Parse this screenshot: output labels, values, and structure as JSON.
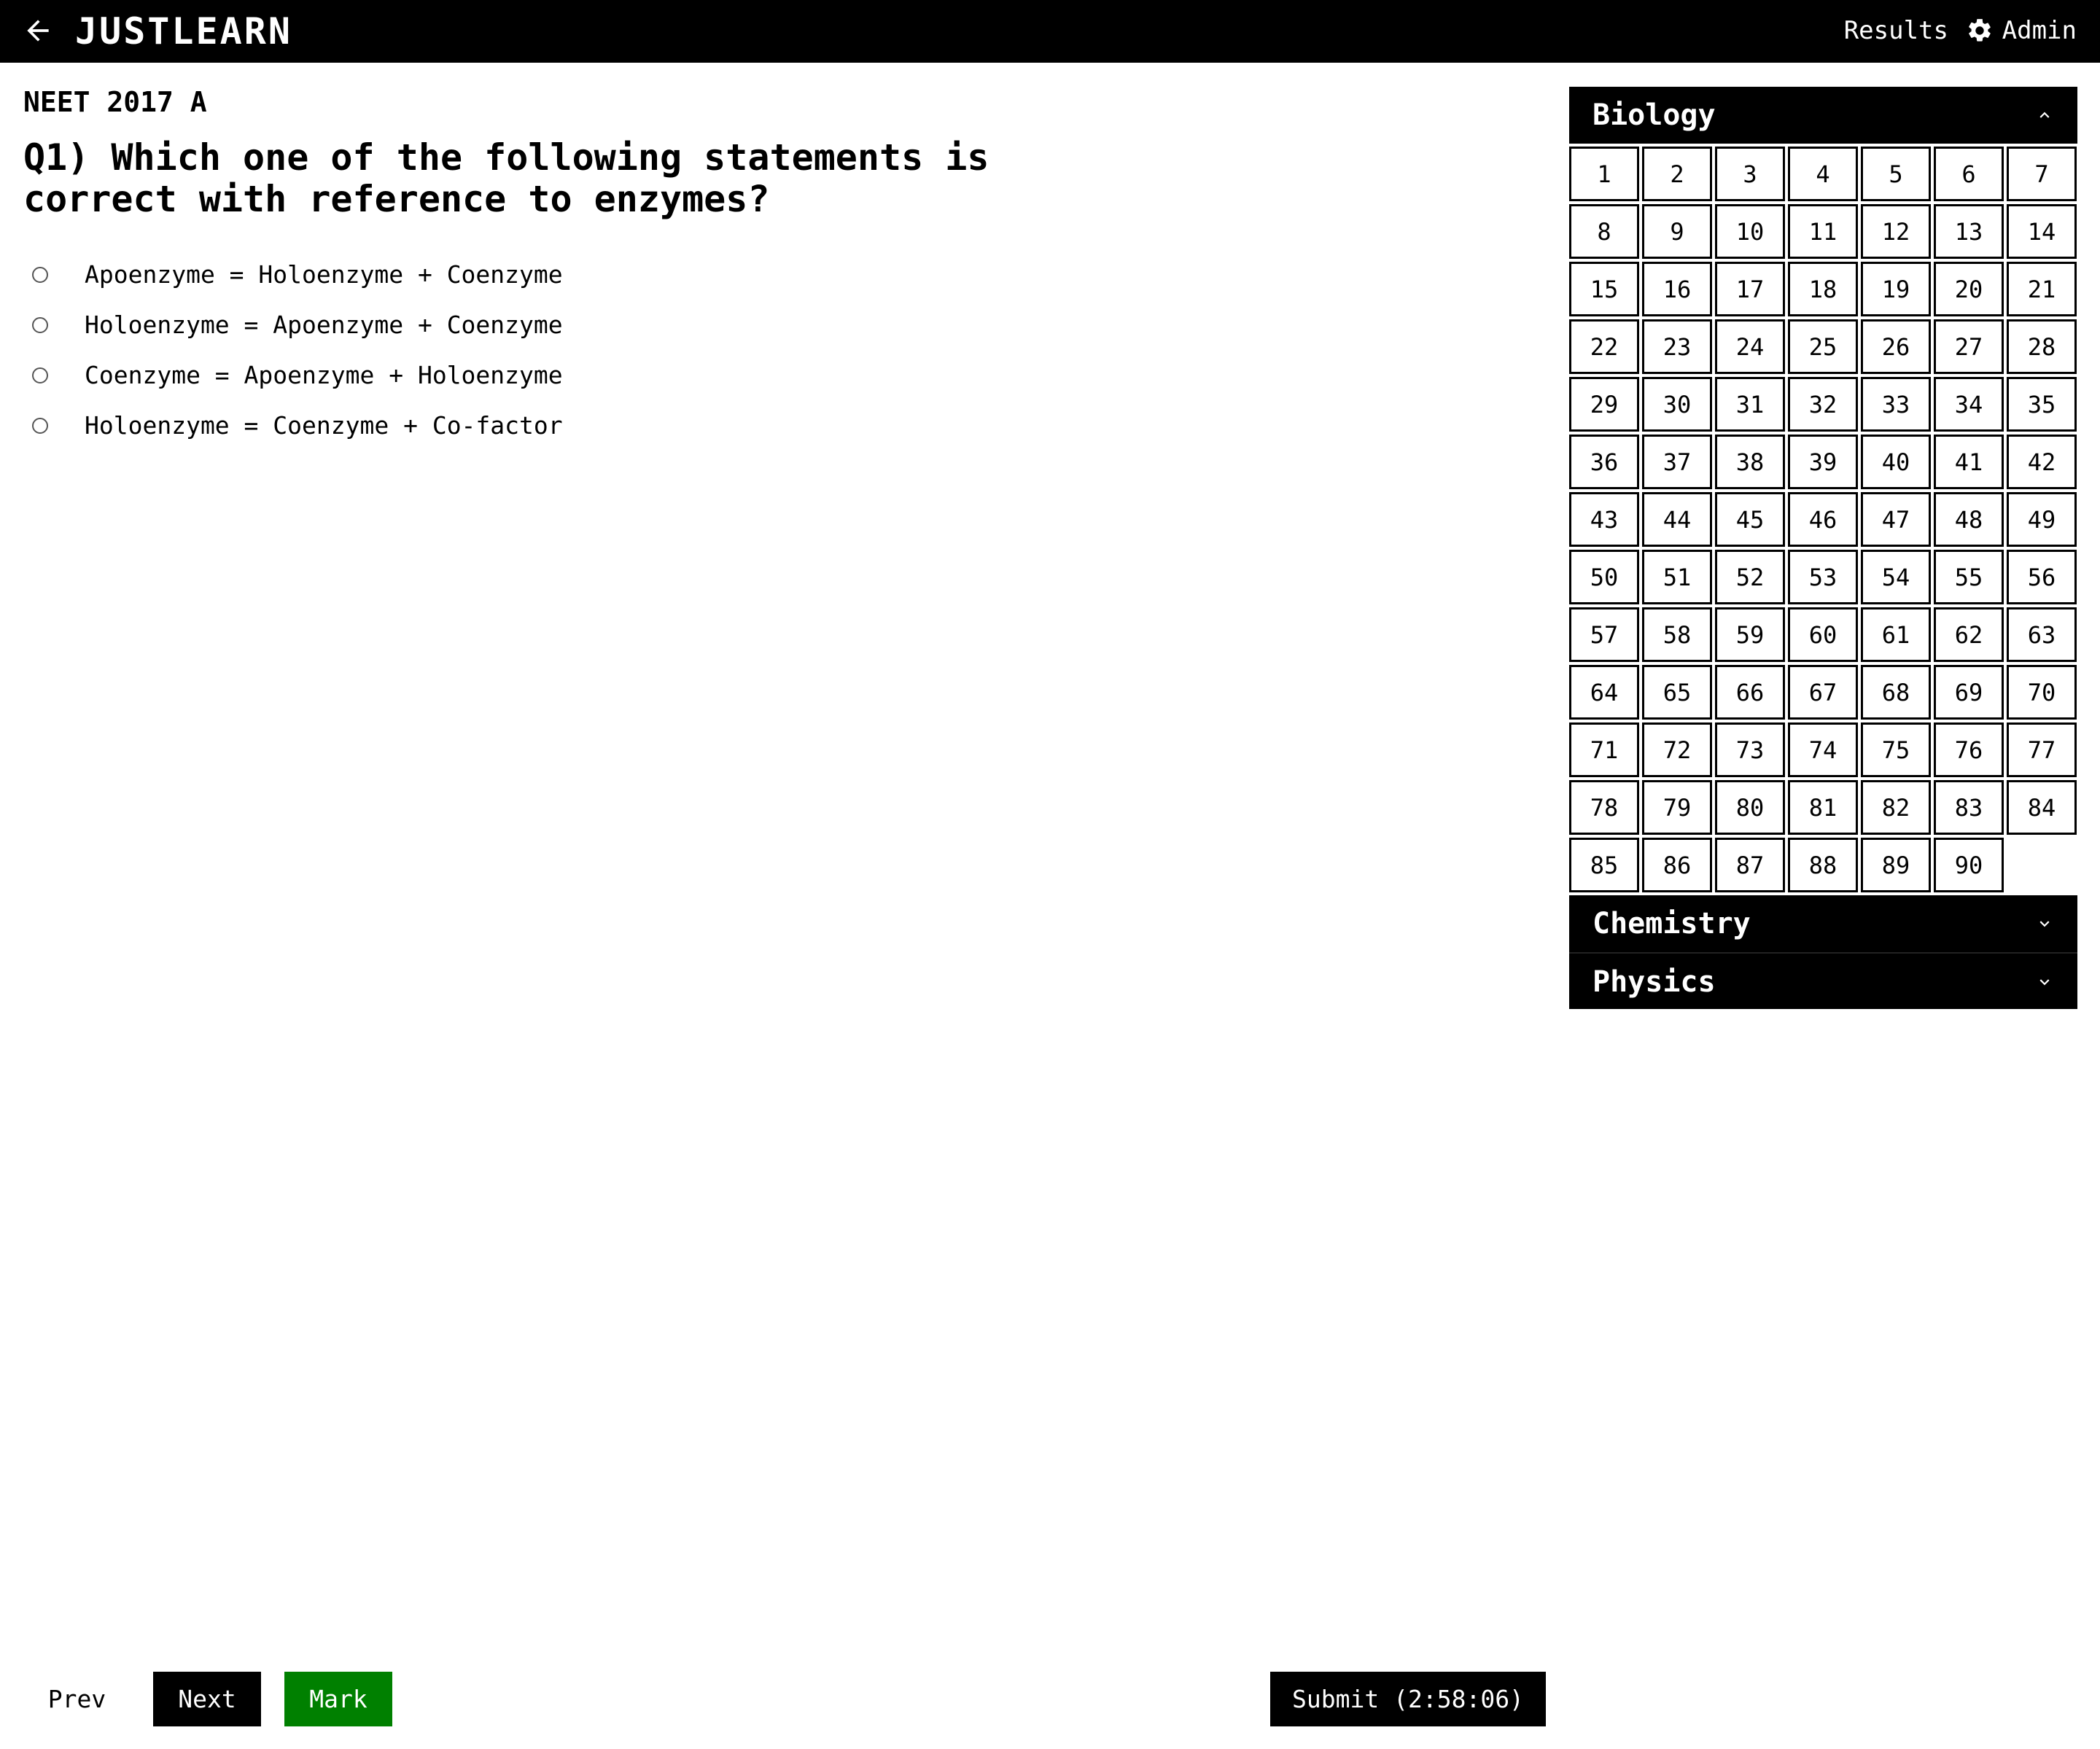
{
  "header": {
    "brand": "JUSTLEARN",
    "nav": {
      "results": "Results",
      "admin": "Admin"
    }
  },
  "exam": {
    "title": "NEET 2017 A"
  },
  "question": {
    "text": "Q1) Which one of the following statements is correct with reference to enzymes?",
    "options": [
      "Apoenzyme = Holoenzyme + Coenzyme",
      "Holoenzyme = Apoenzyme + Coenzyme",
      "Coenzyme = Apoenzyme + Holoenzyme",
      "Holoenzyme = Coenzyme + Co-factor"
    ]
  },
  "panel": {
    "sections": [
      {
        "name": "Biology",
        "expanded": true,
        "question_numbers": [
          "1",
          "2",
          "3",
          "4",
          "5",
          "6",
          "7",
          "8",
          "9",
          "10",
          "11",
          "12",
          "13",
          "14",
          "15",
          "16",
          "17",
          "18",
          "19",
          "20",
          "21",
          "22",
          "23",
          "24",
          "25",
          "26",
          "27",
          "28",
          "29",
          "30",
          "31",
          "32",
          "33",
          "34",
          "35",
          "36",
          "37",
          "38",
          "39",
          "40",
          "41",
          "42",
          "43",
          "44",
          "45",
          "46",
          "47",
          "48",
          "49",
          "50",
          "51",
          "52",
          "53",
          "54",
          "55",
          "56",
          "57",
          "58",
          "59",
          "60",
          "61",
          "62",
          "63",
          "64",
          "65",
          "66",
          "67",
          "68",
          "69",
          "70",
          "71",
          "72",
          "73",
          "74",
          "75",
          "76",
          "77",
          "78",
          "79",
          "80",
          "81",
          "82",
          "83",
          "84",
          "85",
          "86",
          "87",
          "88",
          "89",
          "90"
        ]
      },
      {
        "name": "Chemistry",
        "expanded": false
      },
      {
        "name": "Physics",
        "expanded": false
      }
    ]
  },
  "footer": {
    "prev": "Prev",
    "next": "Next",
    "mark": "Mark",
    "submit": "Submit (2:58:06)"
  },
  "colors": {
    "header_bg": "#000000",
    "mark_button": "#008000",
    "text": "#000000"
  }
}
